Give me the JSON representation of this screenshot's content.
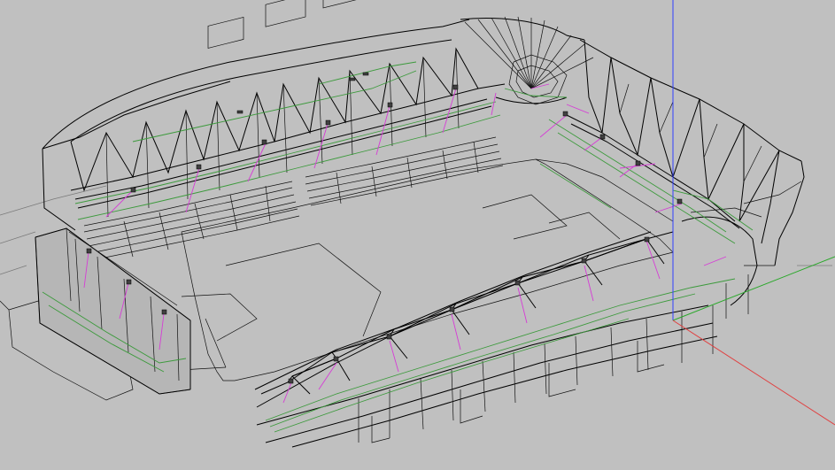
{
  "viewport": {
    "background": "#c0c0c0",
    "line_color": "#000000",
    "structure_accent": "#3c9a3c",
    "light_ray_color": "#d63cd6"
  },
  "axes": {
    "x_color": "#e04040",
    "y_color": "#2aa82a",
    "z_color": "#3040ff"
  },
  "model": {
    "view": "perspective-wireframe"
  }
}
